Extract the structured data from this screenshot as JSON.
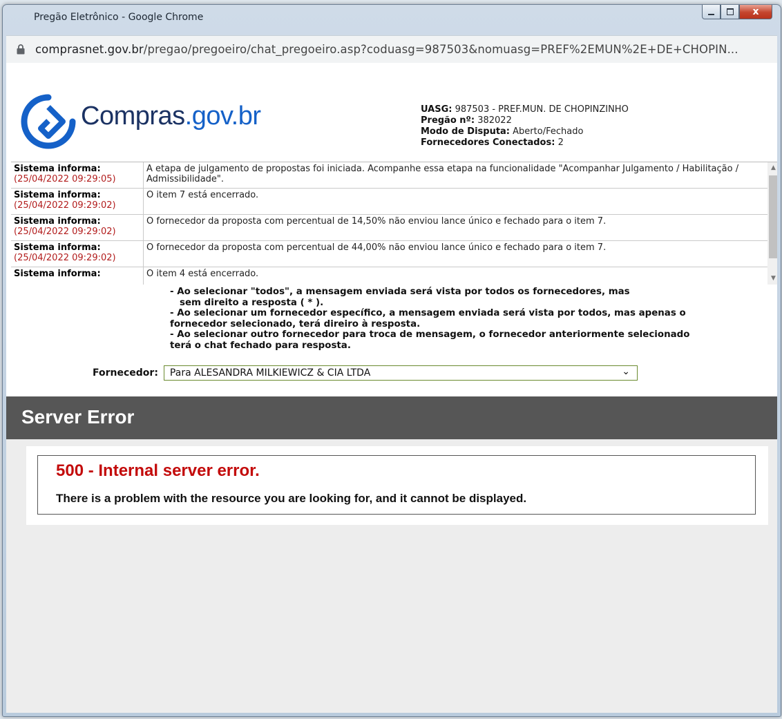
{
  "window": {
    "title": "Pregão Eletrônico - Google Chrome",
    "close_glyph": "x"
  },
  "address_bar": {
    "host": "comprasnet.gov.br",
    "path": "/pregao/pregoeiro/chat_pregoeiro.asp?coduasg=987503&nomuasg=PREF%2EMUN%2E+DE+CHOPIN..."
  },
  "logo": {
    "name": "Compras",
    "domain": ".gov.br"
  },
  "uasg_info": {
    "uasg_label": "UASG:",
    "uasg_value": "987503 - PREF.MUN. DE CHOPINZINHO",
    "pregao_label": "Pregão nº:",
    "pregao_value": "382022",
    "modo_label": "Modo de Disputa:",
    "modo_value": "Aberto/Fechado",
    "conectados_label": "Fornecedores Conectados:",
    "conectados_value": "2"
  },
  "messages": [
    {
      "sender": "Sistema informa:",
      "timestamp": "(25/04/2022 09:29:05)",
      "text": "A etapa de julgamento de propostas foi iniciada. Acompanhe essa etapa na funcionalidade \"Acompanhar Julgamento / Habilitação / Admissibilidade\"."
    },
    {
      "sender": "Sistema informa:",
      "timestamp": "(25/04/2022 09:29:02)",
      "text": "O item 7 está encerrado."
    },
    {
      "sender": "Sistema informa:",
      "timestamp": "(25/04/2022 09:29:02)",
      "text": "O fornecedor da proposta com percentual de 14,50% não enviou lance único e fechado para o item 7."
    },
    {
      "sender": "Sistema informa:",
      "timestamp": "(25/04/2022 09:29:02)",
      "text": "O fornecedor da proposta com percentual de 44,00% não enviou lance único e fechado para o item 7."
    },
    {
      "sender": "Sistema informa:",
      "timestamp": "",
      "text": "O item 4 está encerrado."
    }
  ],
  "instructions": {
    "line1": "- Ao selecionar \"todos\", a mensagem enviada será vista por todos os fornecedores,  mas",
    "line2": "  sem direito a resposta ( * ).",
    "line3": "- Ao selecionar um fornecedor específico, a mensagem enviada será vista por todos, mas   apenas o",
    "line4": "fornecedor selecionado, terá direiro à resposta.",
    "line5": "- Ao selecionar outro fornecedor para troca de mensagem, o fornecedor anteriormente   selecionado",
    "line6": "terá o chat fechado para resposta."
  },
  "fornecedor": {
    "label": "Fornecedor:",
    "selected": "Para ALESANDRA MILKIEWICZ & CIA LTDA"
  },
  "server_error": {
    "title": "Server Error",
    "code": "500 - Internal server error.",
    "message": "There is a problem with the resource you are looking for, and it cannot be displayed."
  }
}
